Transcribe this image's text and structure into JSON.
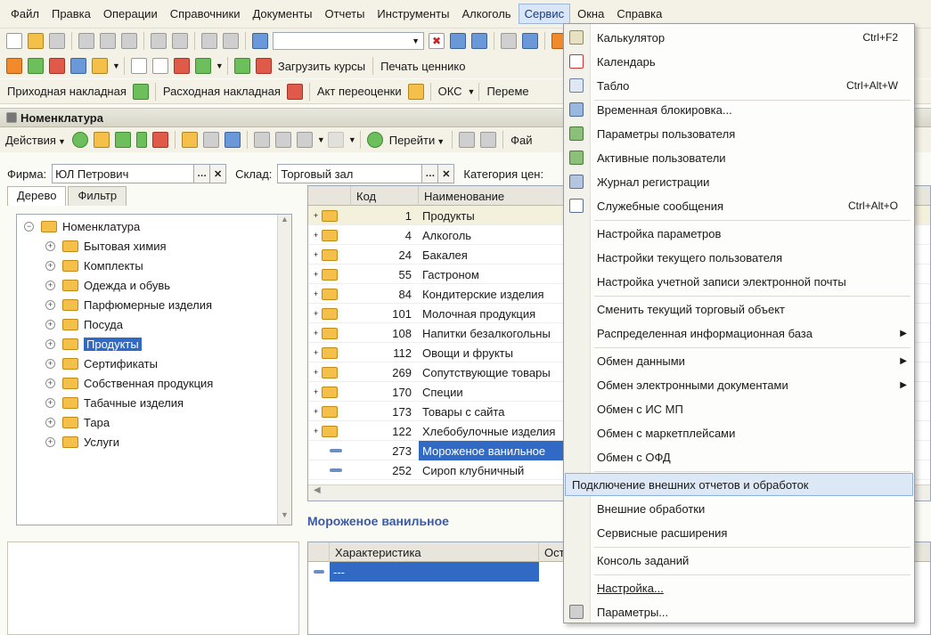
{
  "menubar": {
    "items": [
      "Файл",
      "Правка",
      "Операции",
      "Справочники",
      "Документы",
      "Отчеты",
      "Инструменты",
      "Алкоголь",
      "Сервис",
      "Окна",
      "Справка"
    ]
  },
  "toolbar2": {
    "load_rates": "Загрузить курсы",
    "print_tags": "Печать ценнико"
  },
  "toolbar3": {
    "incoming": "Приходная накладная",
    "outgoing": "Расходная накладная",
    "revaluation": "Акт переоценки",
    "oks": "ОКС",
    "move": "Переме"
  },
  "window": {
    "title": "Номенклатура"
  },
  "actions": {
    "actions": "Действия",
    "goto": "Перейти",
    "files": "Фай"
  },
  "filters": {
    "firm_label": "Фирма:",
    "firm_value": "ЮЛ Петрович",
    "warehouse_label": "Склад:",
    "warehouse_value": "Торговый зал",
    "category_label": "Категория цен:"
  },
  "tabs": {
    "tree": "Дерево",
    "filter": "Фильтр"
  },
  "tree": {
    "root": "Номенклатура",
    "items": [
      "Бытовая химия",
      "Комплекты",
      "Одежда и обувь",
      "Парфюмерные изделия",
      "Посуда",
      "Продукты",
      "Сертификаты",
      "Собственная продукция",
      "Табачные изделия",
      "Тара",
      "Услуги"
    ],
    "selected": "Продукты"
  },
  "grid": {
    "headers": {
      "code": "Код",
      "name": "Наименование"
    },
    "rows": [
      {
        "code": "1",
        "name": "Продукты"
      },
      {
        "code": "4",
        "name": "Алкоголь"
      },
      {
        "code": "24",
        "name": "Бакалея"
      },
      {
        "code": "55",
        "name": "Гастроном"
      },
      {
        "code": "84",
        "name": "Кондитерские изделия"
      },
      {
        "code": "101",
        "name": "Молочная продукция"
      },
      {
        "code": "108",
        "name": "Напитки безалкогольны"
      },
      {
        "code": "112",
        "name": "Овощи и фрукты"
      },
      {
        "code": "269",
        "name": "Сопутствующие товары"
      },
      {
        "code": "170",
        "name": "Специи"
      },
      {
        "code": "173",
        "name": "Товары с сайта"
      },
      {
        "code": "122",
        "name": "Хлебобулочные изделия"
      },
      {
        "code": "273",
        "name": "Мороженое ванильное"
      },
      {
        "code": "252",
        "name": "Сироп клубничный"
      }
    ]
  },
  "selected_item": {
    "title": "Мороженое ванильное"
  },
  "char_grid": {
    "headers": {
      "characteristic": "Характеристика",
      "rest": "Ост"
    },
    "row_value": "---"
  },
  "service_menu": {
    "items": [
      {
        "label": "Калькулятор",
        "shortcut": "Ctrl+F2"
      },
      {
        "label": "Календарь",
        "shortcut": ""
      },
      {
        "label": "Табло",
        "shortcut": "Ctrl+Alt+W"
      },
      {
        "label": "Временная блокировка...",
        "shortcut": ""
      },
      {
        "label": "Параметры пользователя",
        "shortcut": ""
      },
      {
        "label": "Активные пользователи",
        "shortcut": ""
      },
      {
        "label": "Журнал регистрации",
        "shortcut": ""
      },
      {
        "label": "Служебные сообщения",
        "shortcut": "Ctrl+Alt+O"
      },
      {
        "label": "Настройка параметров",
        "shortcut": ""
      },
      {
        "label": "Настройки текущего пользователя",
        "shortcut": ""
      },
      {
        "label": "Настройка учетной записи электронной почты",
        "shortcut": ""
      },
      {
        "label": "Сменить текущий торговый объект",
        "shortcut": ""
      },
      {
        "label": "Распределенная информационная база",
        "shortcut": ""
      },
      {
        "label": "Обмен данными",
        "shortcut": ""
      },
      {
        "label": "Обмен электронными документами",
        "shortcut": ""
      },
      {
        "label": "Обмен с ИС МП",
        "shortcut": ""
      },
      {
        "label": "Обмен с маркетплейсами",
        "shortcut": ""
      },
      {
        "label": "Обмен с ОФД",
        "shortcut": ""
      },
      {
        "label": "Подключение внешних отчетов и обработок",
        "shortcut": ""
      },
      {
        "label": "Внешние обработки",
        "shortcut": ""
      },
      {
        "label": "Сервисные расширения",
        "shortcut": ""
      },
      {
        "label": "Консоль заданий",
        "shortcut": ""
      },
      {
        "label": "Настройка...",
        "shortcut": ""
      },
      {
        "label": "Параметры...",
        "shortcut": ""
      }
    ]
  }
}
